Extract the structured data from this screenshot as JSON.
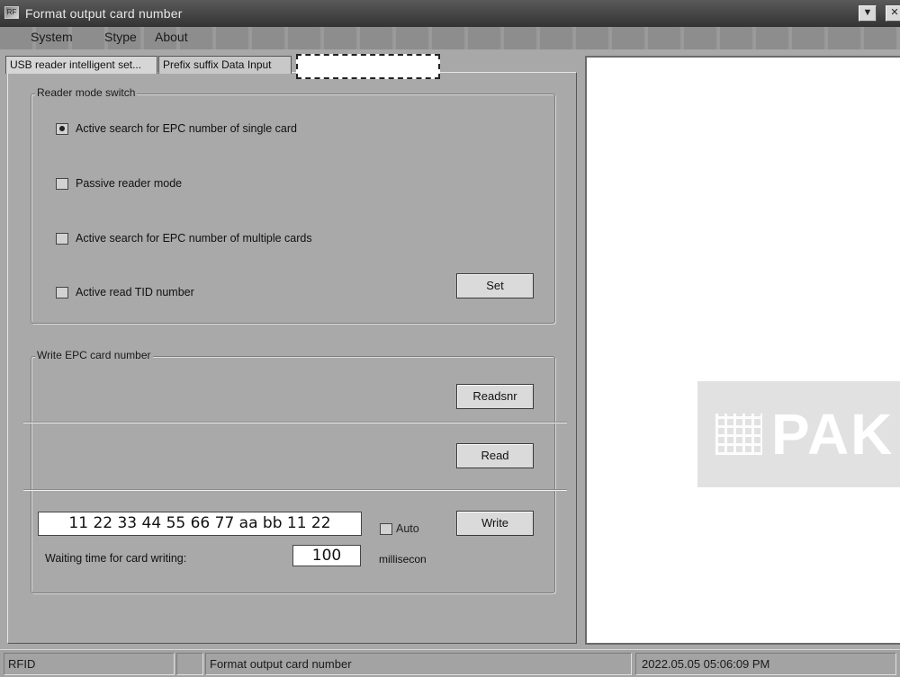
{
  "window": {
    "title": "Format output  card number",
    "icon_label": "RF"
  },
  "menu": {
    "items": [
      "System",
      "Stype",
      "About"
    ]
  },
  "tabs": [
    {
      "label": "USB reader intelligent set..."
    },
    {
      "label": "Prefix suffix Data Input"
    },
    {
      "label": ""
    }
  ],
  "reader_mode": {
    "group_label": "Reader mode switch",
    "options": [
      {
        "label": "Active search for EPC number of single card",
        "selected": true
      },
      {
        "label": "Passive reader mode",
        "selected": false
      },
      {
        "label": "Active search for EPC number of multiple cards",
        "selected": false
      },
      {
        "label": "Active read TID number",
        "selected": false
      }
    ],
    "set_button": "Set"
  },
  "write_epc": {
    "group_label": "Write EPC card number",
    "readsnr_button": "Readsnr",
    "read_button": "Read",
    "epc_value": "11 22 33 44 55 66 77 aa bb 11 22",
    "auto_label": "Auto",
    "auto_checked": false,
    "write_button": "Write",
    "waiting_label": "Waiting time for card writing:",
    "waiting_value": "100",
    "unit_label": "millisecon"
  },
  "watermark": {
    "text": "PAK"
  },
  "statusbar": {
    "app": "RFID",
    "empty": "",
    "mode": "Format output  card number",
    "datetime": "2022.05.05  05:06:09 PM"
  },
  "colors": {
    "panel": "#a9a9a9",
    "button": "#dadada",
    "titlebar": "#3f3f3f"
  }
}
